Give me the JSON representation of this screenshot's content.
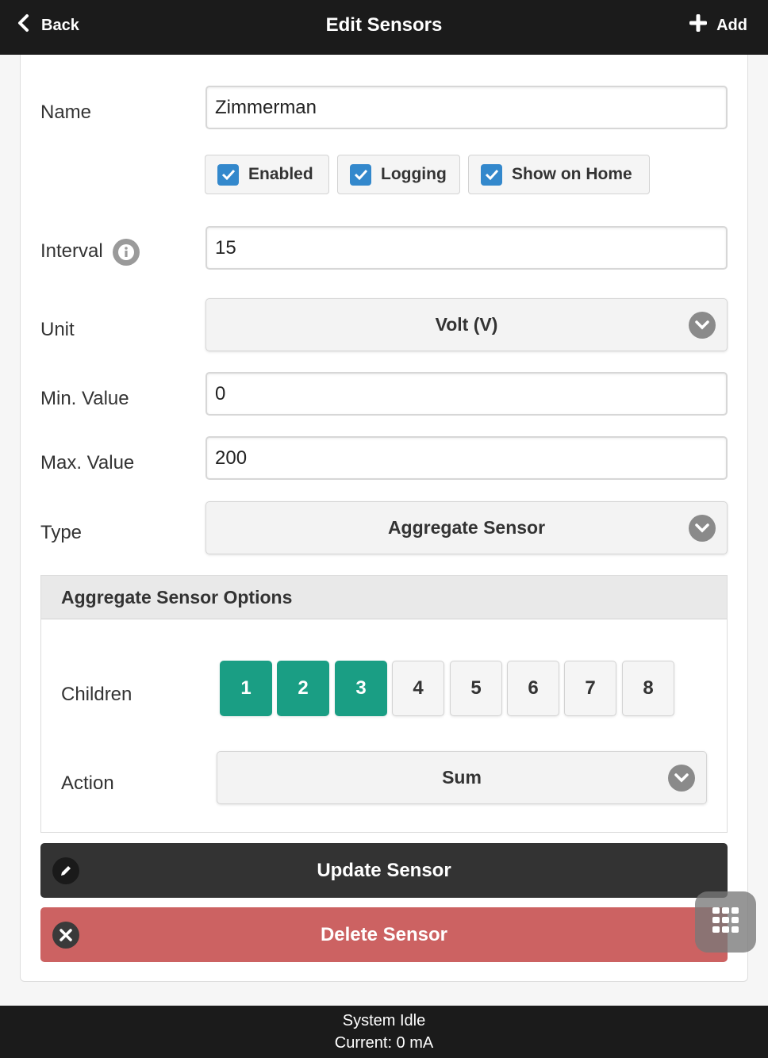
{
  "header": {
    "back_label": "Back",
    "title": "Edit Sensors",
    "add_label": "Add"
  },
  "form": {
    "name_label": "Name",
    "name_value": "Zimmerman",
    "checkboxes": [
      {
        "label": "Enabled",
        "checked": true
      },
      {
        "label": "Logging",
        "checked": true
      },
      {
        "label": "Show on Home",
        "checked": true
      }
    ],
    "interval_label": "Interval",
    "interval_value": "15",
    "unit_label": "Unit",
    "unit_value": "Volt (V)",
    "min_label": "Min. Value",
    "min_value": "0",
    "max_label": "Max. Value",
    "max_value": "200",
    "type_label": "Type",
    "type_value": "Aggregate Sensor"
  },
  "options": {
    "title": "Aggregate Sensor Options",
    "children_label": "Children",
    "children": [
      {
        "label": "1",
        "selected": true
      },
      {
        "label": "2",
        "selected": true
      },
      {
        "label": "3",
        "selected": true
      },
      {
        "label": "4",
        "selected": false
      },
      {
        "label": "5",
        "selected": false
      },
      {
        "label": "6",
        "selected": false
      },
      {
        "label": "7",
        "selected": false
      },
      {
        "label": "8",
        "selected": false
      }
    ],
    "action_label": "Action",
    "action_value": "Sum"
  },
  "buttons": {
    "update_label": "Update Sensor",
    "delete_label": "Delete Sensor"
  },
  "footer": {
    "status": "System Idle",
    "current": "Current: 0 mA"
  },
  "colors": {
    "accent_teal": "#1a9e84",
    "checkbox_blue": "#3388cc",
    "delete_red": "#cc6262",
    "dark": "#1b1b1b"
  },
  "icons": [
    "chevron-left-icon",
    "plus-icon",
    "check-icon",
    "info-icon",
    "chevron-down-icon",
    "pencil-icon",
    "close-icon",
    "grid-icon"
  ]
}
